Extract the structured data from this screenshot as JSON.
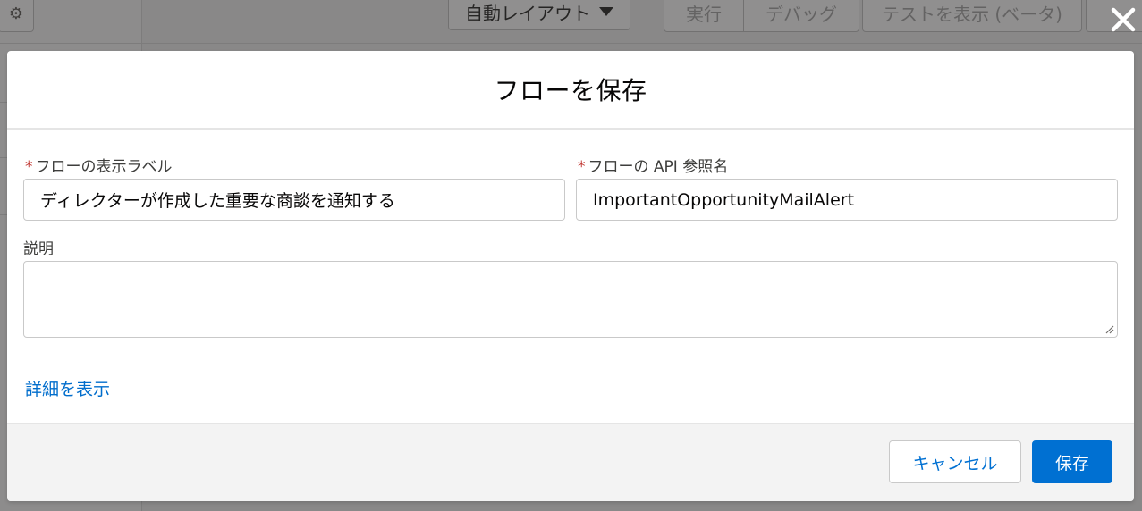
{
  "background": {
    "layout_select": {
      "value": "自動レイアウト"
    },
    "toolbar_buttons": [
      "実行",
      "デバッグ"
    ],
    "test_button": "テストを表示 (ベータ)"
  },
  "modal": {
    "title": "フローを保存",
    "fields": {
      "label": {
        "label": "フローの表示ラベル",
        "required_mark": "*",
        "value": "ディレクターが作成した重要な商談を通知する"
      },
      "api_name": {
        "label": "フローの API 参照名",
        "required_mark": "*",
        "value": "ImportantOpportunityMailAlert"
      },
      "description": {
        "label": "説明",
        "value": ""
      }
    },
    "show_details_link": "詳細を表示",
    "footer": {
      "cancel_label": "キャンセル",
      "save_label": "保存"
    }
  },
  "colors": {
    "brand": "#0070d2",
    "required": "#c23934",
    "link": "#006dcc"
  }
}
